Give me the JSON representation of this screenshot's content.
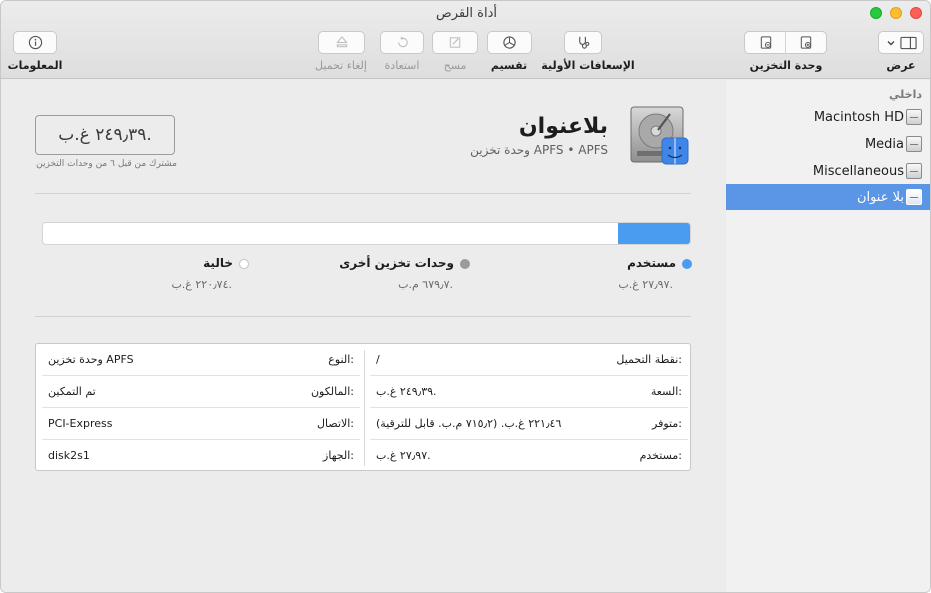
{
  "window": {
    "title": "أداة القرص"
  },
  "toolbar": {
    "info": {
      "label": "المعلومات",
      "icon": "info-icon"
    },
    "unmount": {
      "label": "إلغاء تحميل",
      "icon": "eject-icon"
    },
    "restore": {
      "label": "استعادة",
      "icon": "restore-icon"
    },
    "erase": {
      "label": "مسح",
      "icon": "erase-icon"
    },
    "partition": {
      "label": "تقسيم",
      "icon": "partition-icon"
    },
    "first_aid": {
      "label": "الإسعافات الأولية",
      "icon": "stethoscope-icon"
    },
    "volume": {
      "label": "وحدة التخزين",
      "icon": "volume-icon"
    },
    "view": {
      "label": "عرض",
      "icon": "sidebar-icon"
    }
  },
  "sidebar": {
    "header": "داخلي",
    "items": [
      {
        "label": "Macintosh HD",
        "selected": false
      },
      {
        "label": "Media",
        "selected": false
      },
      {
        "label": "Miscellaneous",
        "selected": false
      },
      {
        "label": "بلا عنوان",
        "selected": true
      }
    ]
  },
  "volume": {
    "name": "بلاعنوان",
    "subtitle": "وحدة تخزين APFS • APFS",
    "capacity": "٢٤٩٫٣٩ غ.ب.",
    "capacity_note": "مشترك من قبل ٦ من وحدات التخزين"
  },
  "usage": {
    "used_fraction": 0.112,
    "used": {
      "label": "مستخدم",
      "value": "٢٧٫٩٧ غ.ب.",
      "color": "#4a9cf0"
    },
    "other": {
      "label": "وحدات تخزين أخرى",
      "value": "٦٧٩٫٧ م.ب.",
      "color": "#9b9b9b"
    },
    "free": {
      "label": "خالية",
      "value": "٢٢٠٫٧٤ غ.ب.",
      "color": "#ffffff"
    }
  },
  "info_table": {
    "right": [
      {
        "key": "نقطة التحميل:",
        "value": "/"
      },
      {
        "key": "السعة:",
        "value": "٢٤٩٫٣٩ غ.ب."
      },
      {
        "key": "متوفر:",
        "value": "٢٢١٫٤٦ غ.ب. (٧١٥٫٢ م.ب. قابل للترقية)"
      },
      {
        "key": "مستخدم:",
        "value": "٢٧٫٩٧ غ.ب."
      }
    ],
    "left": [
      {
        "key": "النوع:",
        "value": "وحدة تخزين APFS"
      },
      {
        "key": "المالكون:",
        "value": "تم التمكين"
      },
      {
        "key": "الاتصال:",
        "value": "PCI-Express"
      },
      {
        "key": "الجهاز:",
        "value": "disk2s1"
      }
    ]
  }
}
